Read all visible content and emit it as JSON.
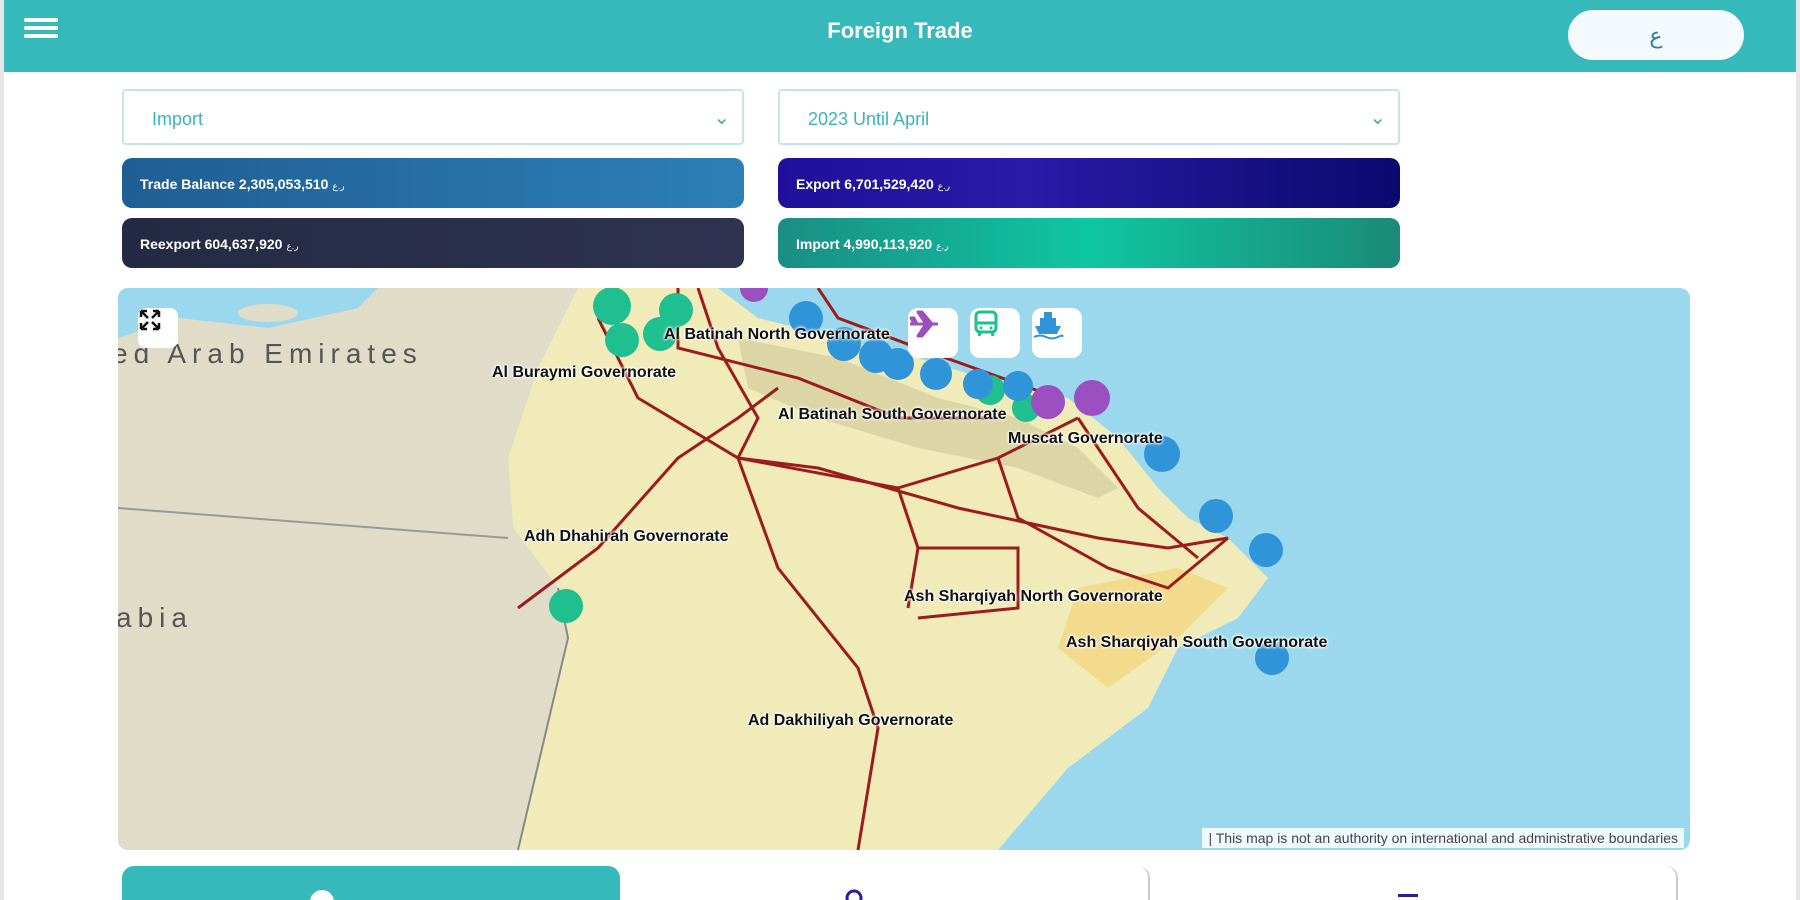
{
  "header": {
    "title": "Foreign Trade",
    "lang_label": "ع"
  },
  "filters": {
    "trade_type": "Import",
    "period": "2023 Until April"
  },
  "stats": {
    "trade_balance": {
      "label": "Trade Balance",
      "value": "2,305,053,510",
      "unit": "ر.ع"
    },
    "export": {
      "label": "Export",
      "value": "6,701,529,420",
      "unit": "ر.ع"
    },
    "reexport": {
      "label": "Reexport",
      "value": "604,637,920",
      "unit": "ر.ع"
    },
    "import": {
      "label": "Import",
      "value": "4,990,113,920",
      "unit": "ر.ع"
    }
  },
  "map": {
    "countries": [
      "ed Arab Emirates",
      "abia"
    ],
    "governorates": [
      "Al Batinah North Governorate",
      "Al Buraymi Governorate",
      "Al Batinah South Governorate",
      "Muscat Governorate",
      "Adh Dhahirah Governorate",
      "Ash Sharqiyah North Governorate",
      "Ash Sharqiyah South Governorate",
      "Ad Dakhiliyah Governorate"
    ],
    "disclaimer": "| This map is not an authority on international and administrative boundaries",
    "colors": {
      "sea": "#9bd8ee",
      "land": "#f0ebb8",
      "neighbor": "#e0dcc8",
      "roads": "#9b1c1c",
      "green_marker": "#1fbf8f",
      "blue_marker": "#2f95d8",
      "purple_marker": "#9b4fc0"
    },
    "mode_icons": [
      "airplane-icon",
      "bus-icon",
      "ship-icon"
    ]
  }
}
